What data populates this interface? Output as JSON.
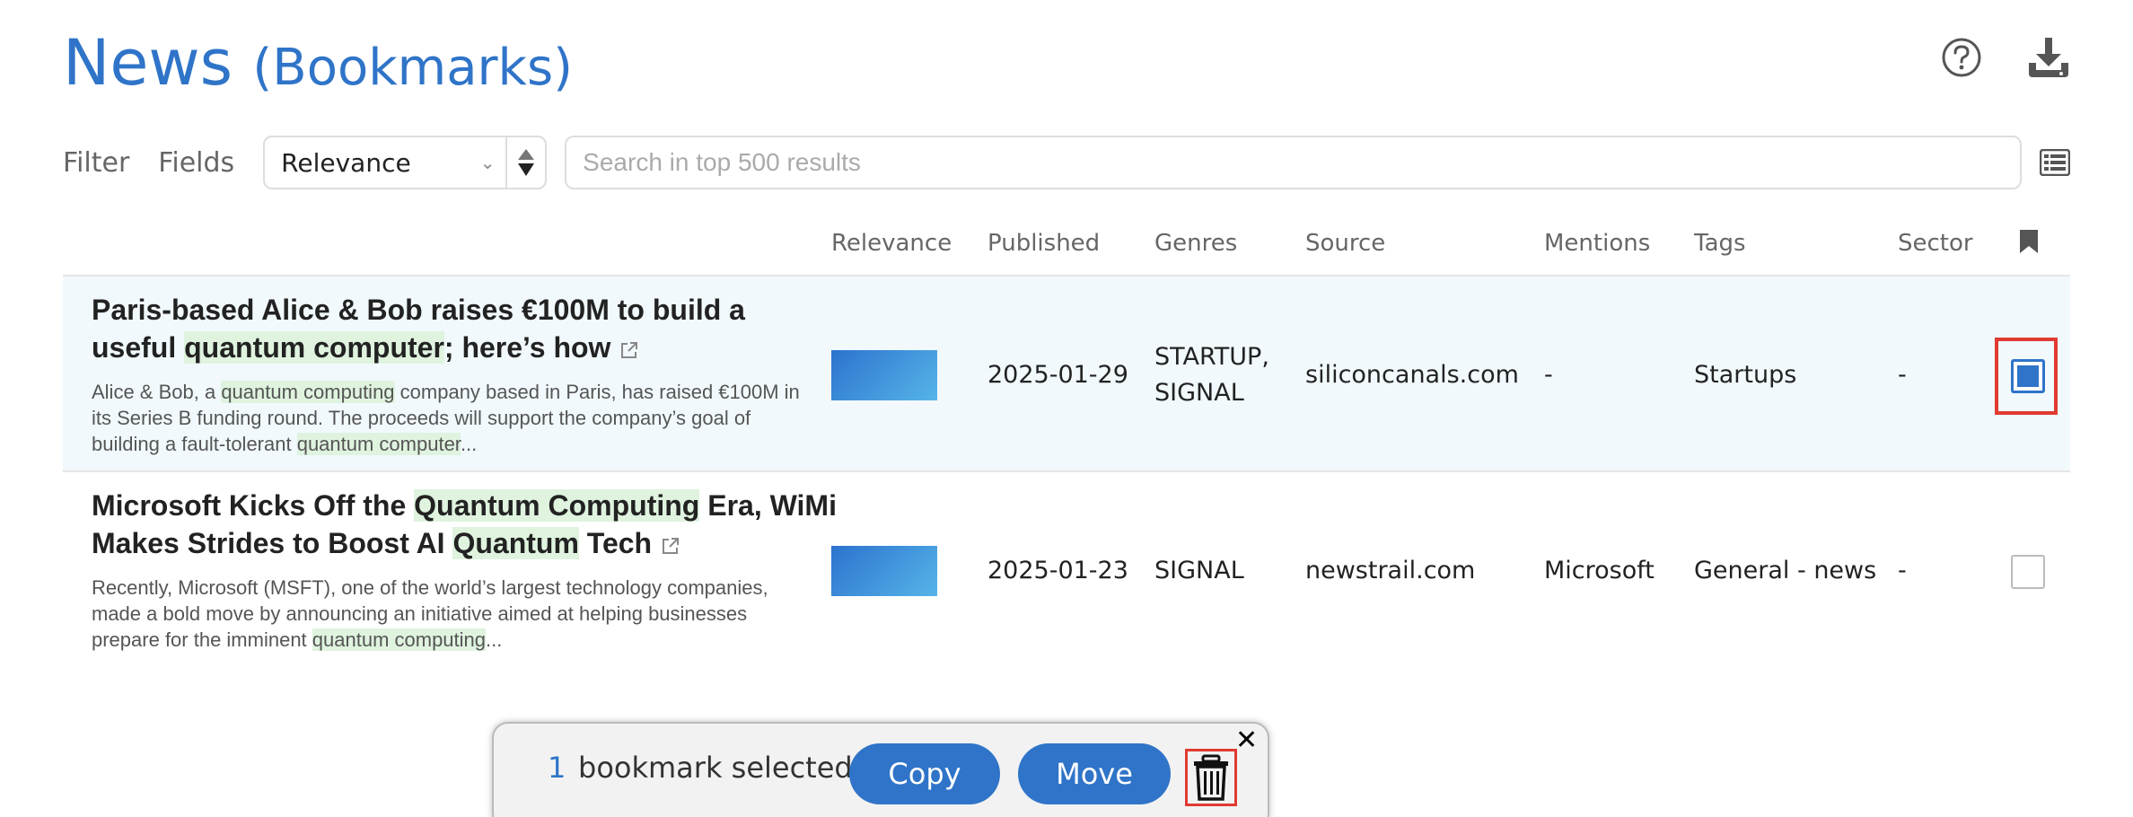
{
  "header": {
    "title": "News",
    "subtitle": "(Bookmarks)",
    "icons": [
      "help-icon",
      "download-icon"
    ]
  },
  "toolbar": {
    "filter_label": "Filter",
    "fields_label": "Fields",
    "sort_value": "Relevance",
    "search_placeholder": "Search in top 500 results",
    "icons": [
      "sort-order-icon",
      "list-view-icon"
    ]
  },
  "table": {
    "columns": [
      "Relevance",
      "Published",
      "Genres",
      "Source",
      "Mentions",
      "Tags",
      "Sector"
    ],
    "rows": [
      {
        "title_parts": [
          "Paris-based Alice & Bob raises €100M to build a useful ",
          "quantum computer",
          "; here’s how"
        ],
        "snippet_parts": [
          "Alice & Bob, a ",
          "quantum computing",
          " company based in Paris, has raised €100M in its Series B funding round. The proceeds will support the company’s goal of building a fault-tolerant ",
          "quantum computer",
          "..."
        ],
        "published": "2025-01-29",
        "genres_line1": "STARTUP,",
        "genres_line2": "SIGNAL",
        "source": "siliconcanals.com",
        "mentions": "-",
        "tags": "Startups",
        "sector": "-",
        "bookmarked": true
      },
      {
        "title_parts": [
          "Microsoft Kicks Off the ",
          "Quantum Computing",
          " Era, WiMi Makes Strides to Boost AI ",
          "Quantum",
          " Tech"
        ],
        "snippet_parts": [
          "Recently, Microsoft (MSFT), one of the world’s largest technology companies, made a bold move by announcing an initiative aimed at helping businesses prepare for the imminent ",
          "quantum computing",
          "..."
        ],
        "published": "2025-01-23",
        "genres_line1": "SIGNAL",
        "source": "newstrail.com",
        "mentions": "Microsoft",
        "tags": "General - news",
        "sector": "-",
        "bookmarked": false
      }
    ]
  },
  "action_bar": {
    "count": "1",
    "selected_text": "bookmark selected",
    "copy_label": "Copy",
    "move_label": "Move",
    "icons": [
      "trash-icon",
      "close-icon"
    ]
  },
  "colors": {
    "accent": "#2f74c8",
    "highlight": "#dff3df",
    "selected_row": "#f1f9fd",
    "annotation_red": "#e03a31"
  }
}
